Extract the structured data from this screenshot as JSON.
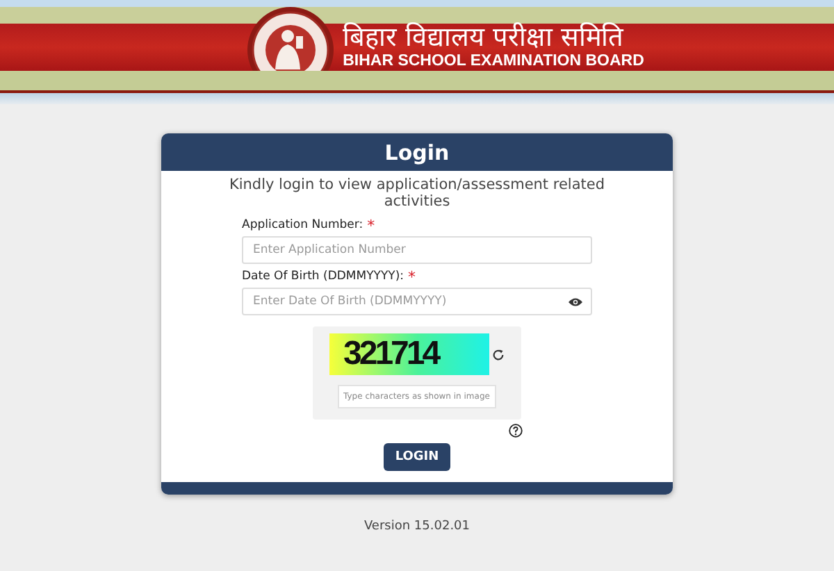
{
  "header": {
    "title_hindi": "बिहार विद्यालय परीक्षा समिति",
    "title_english": "BIHAR SCHOOL EXAMINATION BOARD"
  },
  "login": {
    "title": "Login",
    "subtitle": "Kindly login to view application/assessment related activities",
    "fields": [
      {
        "label": "Application Number:",
        "required_mark": "*",
        "placeholder": "Enter Application Number",
        "kind": "text"
      },
      {
        "label": "Date Of Birth (DDMMYYYY):",
        "required_mark": "*",
        "placeholder": "Enter Date Of Birth (DDMMYYYY)",
        "kind": "password"
      }
    ],
    "captcha": {
      "code": "321714",
      "placeholder": "Type characters as shown in image"
    },
    "button": "LOGIN"
  },
  "version": "Version 15.02.01"
}
